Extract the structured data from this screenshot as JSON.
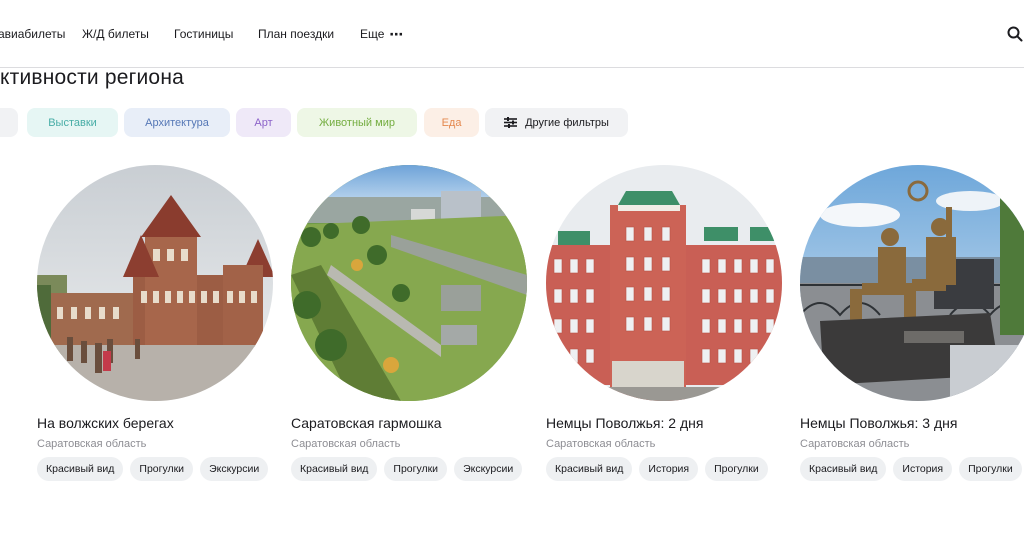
{
  "nav": {
    "items": [
      "авиабилеты",
      "Ж/Д билеты",
      "Гостиницы",
      "План поездки"
    ],
    "more_label": "Еще"
  },
  "section_title": "ктивности региона",
  "filters": {
    "chips": [
      "Выставки",
      "Архитектура",
      "Арт",
      "Животный мир",
      "Еда"
    ],
    "other_filters_label": "Другие фильтры"
  },
  "cards": [
    {
      "title": "На волжских берегах",
      "region": "Саратовская область",
      "tags": [
        "Красивый вид",
        "Прогулки",
        "Экскурсии"
      ]
    },
    {
      "title": "Саратовская гармошка",
      "region": "Саратовская область",
      "tags": [
        "Красивый вид",
        "Прогулки",
        "Экскурсии"
      ]
    },
    {
      "title": "Немцы Поволжья: 2 дня",
      "region": "Саратовская область",
      "tags": [
        "Красивый вид",
        "История",
        "Прогулки"
      ]
    },
    {
      "title": "Немцы Поволжья: 3 дня",
      "region": "Саратовская область",
      "tags": [
        "Красивый вид",
        "История",
        "Прогулки"
      ]
    }
  ],
  "colors": {
    "chip_exhibitions": "#47ada6",
    "chip_architecture": "#5577b6",
    "chip_art": "#8c62c9",
    "chip_animals": "#74ad40",
    "chip_food": "#e4884e"
  }
}
